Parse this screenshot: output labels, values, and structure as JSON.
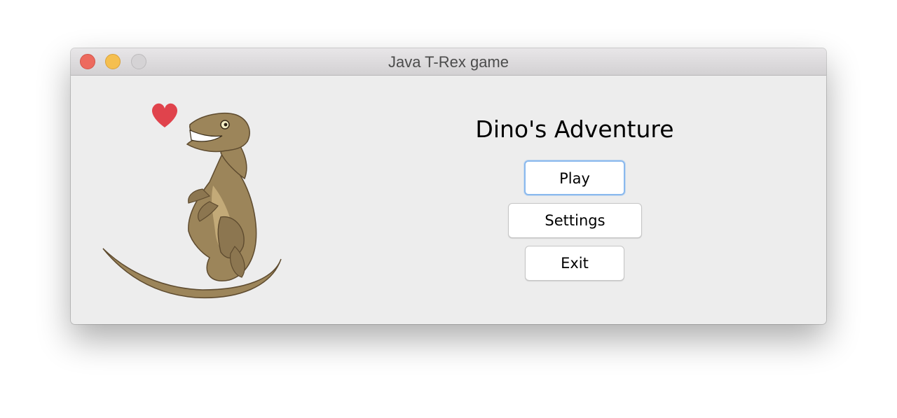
{
  "window": {
    "title": "Java T-Rex game"
  },
  "menu": {
    "heading": "Dino's Adventure",
    "buttons": {
      "play": "Play",
      "settings": "Settings",
      "exit": "Exit"
    }
  },
  "icons": {
    "illustration": "velociraptor-illustration",
    "heart": "heart-icon"
  },
  "colors": {
    "close": "#ed6a5e",
    "minimize": "#f5bf4f",
    "zoom_disabled": "#d5d3d5",
    "focus_ring": "#8ab9ee",
    "heart": "#e0434c",
    "dino_body": "#9c855a"
  }
}
